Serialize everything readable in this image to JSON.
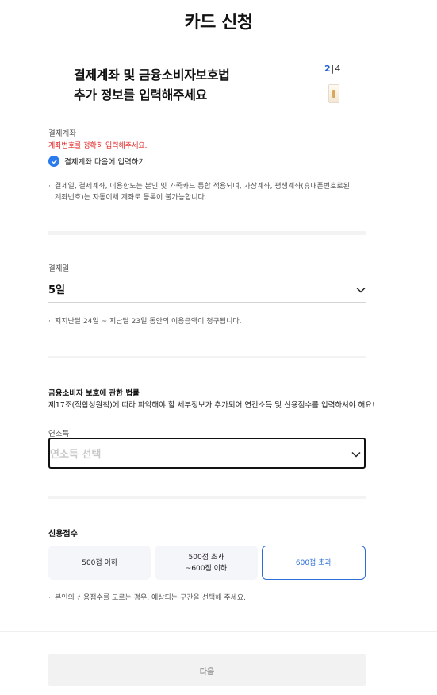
{
  "header": {
    "title": "카드 신청"
  },
  "intro": {
    "line1": "결제계좌 및 금융소비자보호법",
    "line2": "추가 정보를 입력해주세요",
    "step_current": "2",
    "step_separator": "|",
    "step_total": "4"
  },
  "account": {
    "label": "결제계좌",
    "error": "계좌번호를 정확히 입력해주세요.",
    "later_checkbox_label": "결제계좌 다음에 입력하기",
    "later_checked": true,
    "note_line1": "결제일, 결제계좌, 이용한도는 본인 및 가족카드 통합 적용되며, 가상계좌, 평생계좌(휴대폰번호로된",
    "note_line2": "계좌번호)는 자동이체 계좌로 등록이 불가능합니다."
  },
  "payment_day": {
    "label": "결제일",
    "value": "5일",
    "note": "지지난달 24일 ~ 지난달 23일 동안의 이용금액이 청구됩니다."
  },
  "consumer_law": {
    "title": "금융소비자 보호에 관한 법률",
    "description": "제17조(적합성원칙)에 따라 파악해야 할 세부정보가 추가되어 연간소득 및 신용점수를 입력하셔야 해요!"
  },
  "income": {
    "label": "연소득",
    "placeholder": "연소득 선택"
  },
  "credit_score": {
    "title": "신용점수",
    "options": [
      {
        "line1": "500점 이하",
        "line2": ""
      },
      {
        "line1": "500점 초과",
        "line2": "~600점 이하"
      },
      {
        "line1": "600점 초과",
        "line2": ""
      }
    ],
    "selected_index": 2,
    "note": "본인의 신용점수를 모르는 경우, 예상되는 구간을 선택해 주세요."
  },
  "footer": {
    "next_label": "다음"
  },
  "colors": {
    "accent": "#2b6fd6",
    "error": "#e02020",
    "checkbox": "#2b7bef"
  }
}
